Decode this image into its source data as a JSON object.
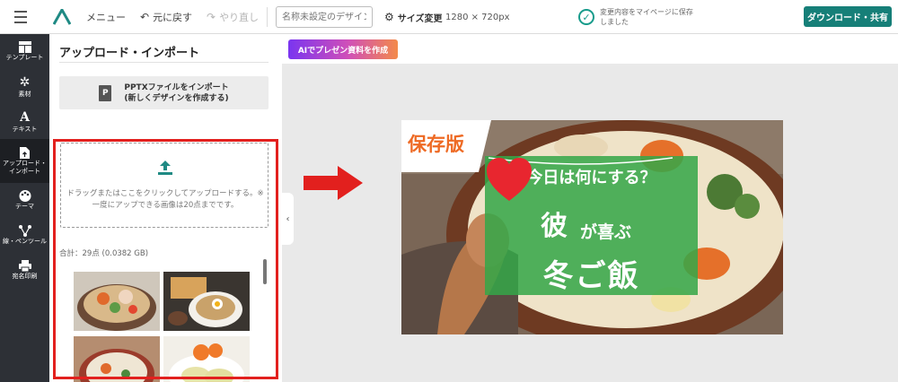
{
  "topbar": {
    "menu": "メニュー",
    "undo": "元に戻す",
    "redo": "やり直し",
    "design_name_placeholder": "名称未設定のデザイン",
    "resize": "サイズ変更",
    "size": "1280 × 720px",
    "saved_status": "変更内容をマイページに保存しました",
    "download": "ダウンロード・共有",
    "accent_color": "#167f78"
  },
  "nav": {
    "items": [
      {
        "label": "テンプレート",
        "icon": "template-icon"
      },
      {
        "label": "素材",
        "icon": "gear-icon"
      },
      {
        "label": "テキスト",
        "icon": "text-a-icon"
      },
      {
        "label": "アップロード・インポート",
        "icon": "file-upload-icon"
      },
      {
        "label": "テーマ",
        "icon": "palette-icon"
      },
      {
        "label": "線・ペンツール",
        "icon": "pen-tool-icon"
      },
      {
        "label": "宛名印刷",
        "icon": "printer-icon"
      }
    ],
    "active": "アップロード・インポート"
  },
  "panel": {
    "title": "アップロード・インポート",
    "pptx_line1": "PPTXファイルをインポート",
    "pptx_line2": "(新しくデザインを作成する)",
    "drop_text": "ドラッグまたはここをクリックしてアップロードする。※一度にアップできる画像は20点までです。",
    "total": "合計：29点 (0.0382 GB)",
    "frame_color": "#e2201e"
  },
  "ai_button": "AIでプレゼン資料を作成",
  "slide": {
    "tag": "保存版",
    "question": "今日は何にする？",
    "kare": "彼",
    "ga_yorokobu": "が喜ぶ",
    "fuyu_gohan": "冬ご飯",
    "green": "#34a648",
    "orange": "#ee6a24"
  }
}
